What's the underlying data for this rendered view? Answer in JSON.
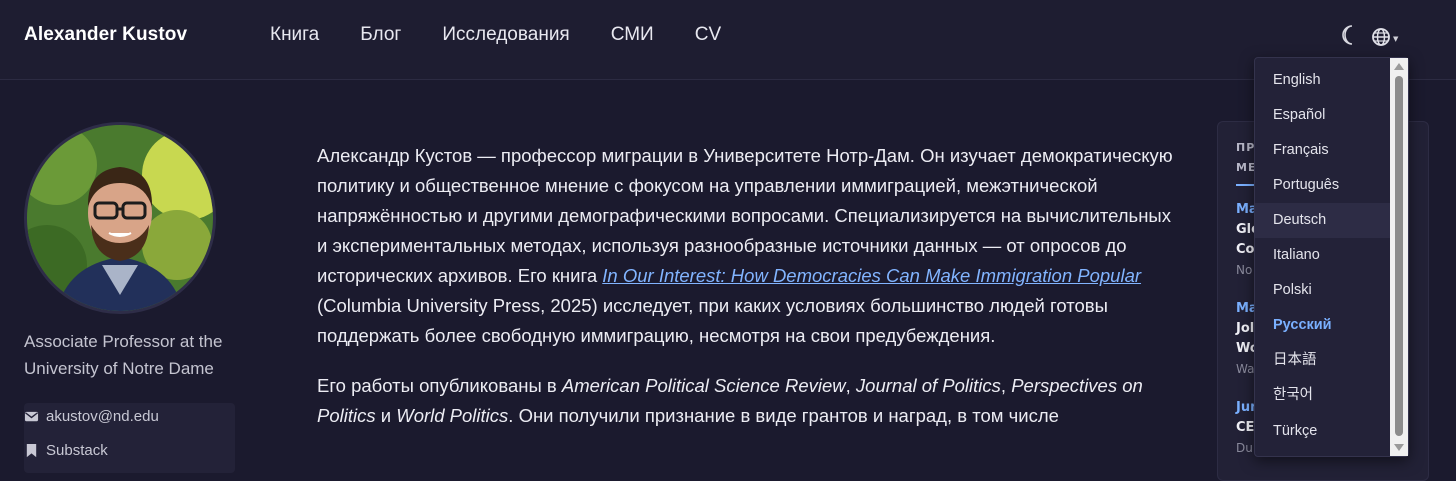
{
  "nav": {
    "brand": "Alexander Kustov",
    "links": [
      "Книга",
      "Блог",
      "Исследования",
      "СМИ",
      "CV"
    ]
  },
  "sidebar": {
    "role_line1": "Associate Professor at the",
    "role_line2": "University of Notre Dame",
    "email": "akustov@nd.edu",
    "substack": "Substack"
  },
  "main": {
    "p1_part1": "Александр Кустов — профессор миграции в Университете Нотр-Дам. Он изучает демократическую политику и общественное мнение с фокусом на управлении иммиграцией, межэтнической напряжённостью и другими демографическими вопросами. Специализируется на вычислительных и экспериментальных методах, используя разнообразные источники данных — от опросов до исторических архивов. Его книга ",
    "book_title": "In Our Interest: How Democracies Can Make Immigration Popular",
    "p1_part2": " (Columbia University Press, 2025) исследует, при каких условиях большинство людей готовы поддержать более свободную иммиграцию, несмотря на свои предубеждения.",
    "p2_part1": "Его работы опубликованы в ",
    "j1": "American Political Science Review",
    "sep1": ", ",
    "j2": "Journal of Politics",
    "sep2": ", ",
    "j3": "Perspectives on Politics",
    "sep3": " и ",
    "j4": "World Politics",
    "p2_part2": ". Они получили признание в виде грантов и наград, в том числе"
  },
  "news": {
    "heading_line1": "ПР",
    "heading_line2": "МЕ",
    "items": [
      {
        "date": "Ma",
        "title1": "Glo",
        "title2": "Co",
        "src": "No"
      },
      {
        "date": "Ma",
        "title1": "Jol",
        "title2": "Wo",
        "src": "Wa"
      },
      {
        "date": "Jun",
        "title1": "CE",
        "title2": "",
        "src": "Du"
      }
    ]
  },
  "languages": {
    "items": [
      "English",
      "Español",
      "Français",
      "Português",
      "Deutsch",
      "Italiano",
      "Polski",
      "Русский",
      "日本語",
      "한국어",
      "Türkçe"
    ],
    "active": "Русский",
    "hovered": "Deutsch"
  },
  "colors": {
    "background": "#1b1a2e",
    "accent": "#7ab0ff",
    "link": "#82b4ff"
  }
}
